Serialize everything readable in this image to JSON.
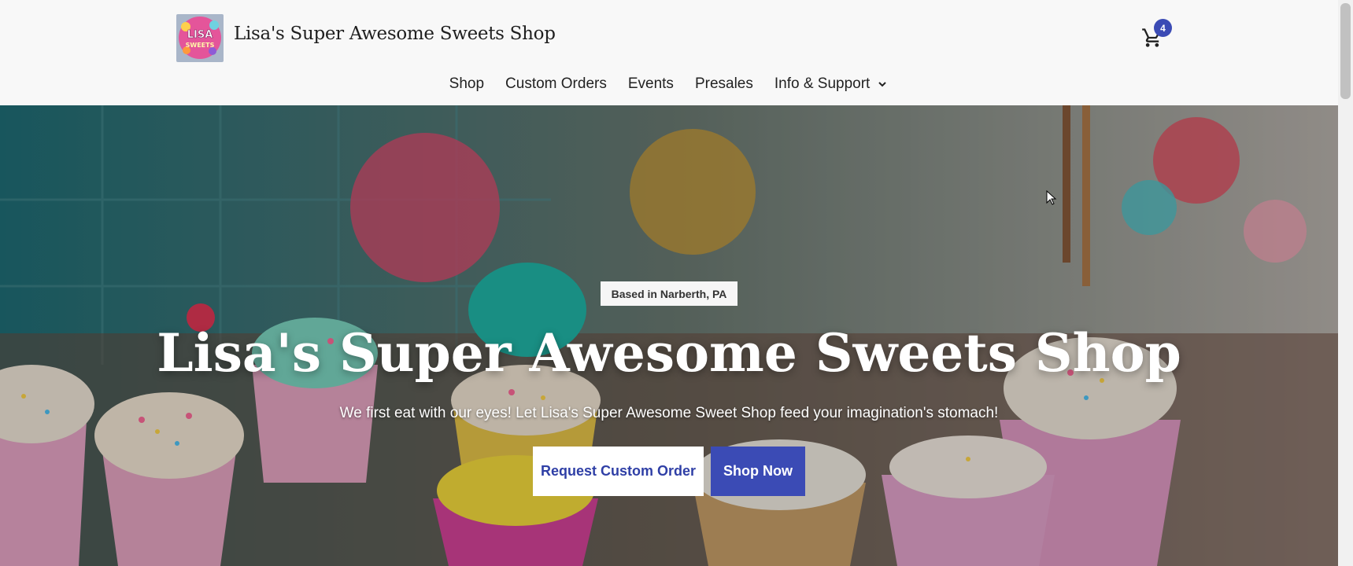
{
  "header": {
    "site_title": "Lisa's Super Awesome Sweets Shop",
    "logo_lines": [
      "LISA",
      "SWEETS"
    ],
    "cart_count": "4"
  },
  "nav": {
    "items": [
      {
        "label": "Shop",
        "icon": ""
      },
      {
        "label": "Custom Orders",
        "icon": ""
      },
      {
        "label": "Events",
        "icon": ""
      },
      {
        "label": "Presales",
        "icon": ""
      },
      {
        "label": "Info & Support",
        "icon": "chevron-down-icon"
      }
    ]
  },
  "hero": {
    "location_badge": "Based in Narberth, PA",
    "title": "Lisa's Super Awesome Sweets Shop",
    "subtitle": "We first eat with our eyes! Let Lisa's Super Awesome Sweet Shop feed your imagination's stomach!",
    "buttons": {
      "custom_order": "Request Custom Order",
      "shop_now": "Shop Now"
    }
  },
  "colors": {
    "accent": "#3b4bb5",
    "header_bg": "#f8f8f8"
  }
}
